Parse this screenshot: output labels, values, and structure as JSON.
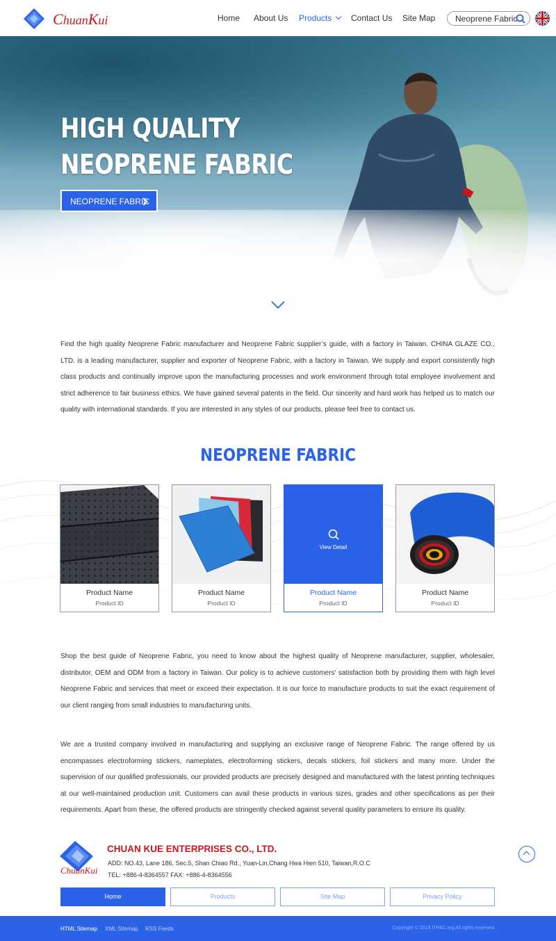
{
  "header": {
    "logo_text_c": "C",
    "logo_text_huan": "huan",
    "logo_text_k": "K",
    "logo_text_ui": "ui",
    "nav": [
      {
        "label": "Home"
      },
      {
        "label": "About Us"
      },
      {
        "label": "Products"
      },
      {
        "label": "Contact Us"
      },
      {
        "label": "Site Map"
      }
    ],
    "search_value": "Neoprene Fabric",
    "language_icon": "uk-flag-icon"
  },
  "hero": {
    "title_line1": "HIGH QUALITY",
    "title_line2": "NEOPRENE FABRIC",
    "button_label": "NEOPRENE FABRIC"
  },
  "intro_text": "Find the high quality Neoprene Fabric manufacturer and Neoprene Fabric supplier’s guide, with a factory in Taiwan. CHINA GLAZE CO., LTD. is a leading manufacturer, supplier and exporter of Neoprene Fabric, with a factory in Taiwan. We supply and export consistently high class products and continually improve upon the manufacturing processes and work environment through total employee involvement and strict adherence to fair business ethics. We have gained several patents in the field. Our sincerity and hard work has helped us to match our quality with international standards. If you are interested in any styles of our products, please feel free to contact us.",
  "section": {
    "title": "NEOPRENE FABRIC",
    "view_detail": "View Detail",
    "products": [
      {
        "name": "Product Name",
        "id": "Product ID"
      },
      {
        "name": "Product Name",
        "id": "Product ID"
      },
      {
        "name": "Product Name",
        "id": "Product ID"
      },
      {
        "name": "Product Name",
        "id": "Product ID"
      }
    ]
  },
  "body_text_1": "Shop the best guide of Neoprene Fabric, you need to know about the highest quality of Neoprene manufacturer, supplier, wholesaler, distributor, OEM and ODM from a factory in Taiwan. Our policy is to achieve customers' satisfaction both by providing them with high level Neoprene Fabric and services that meet or exceed their expectation. It is our force to manufacture products to suit the exact requirement of our client ranging from small industries to manufacturing units.",
  "body_text_2": "We are a trusted company involved in manufacturing and supplying an exclusive range of Neoprene Fabric. The range offered by us encompasses electroforming stickers, nameplates, electroforming stickers, decals stickers, foil stickers and many more. Under the supervision of our qualified professionals, our provided products are precisely designed and manufactured with the latest printing techniques at our well-maintained production unit. Customers can avail these products in various sizes, grades and other specifications as per their requirements. Apart from these, the offered products are stringently checked against several quality parameters to ensure its quality.",
  "footer": {
    "logo_text": "ChuanKui",
    "company": "CHUAN KUE ENTERPRISES CO., LTD.",
    "address": "ADD: NO.43, Lane 186, Sec.5, Shan Chiao Rd., Yuan-Lin,Chang Hwa Hien 510, Taiwan,R.O.C",
    "tel_fax": "TEL: +886-4-8364557    FAX: +886-4-8364556",
    "buttons": [
      "Home",
      "Products",
      "Site Map",
      "Privacy Policy"
    ],
    "links": [
      "HTML Sitemap",
      "XML Sitemap",
      "RSS Feeds"
    ],
    "copyright": "Copyright © 2019 ITPAC.org All rights reserved."
  },
  "colors": {
    "accent": "#2b63e8",
    "brand_red": "#c8161d"
  }
}
